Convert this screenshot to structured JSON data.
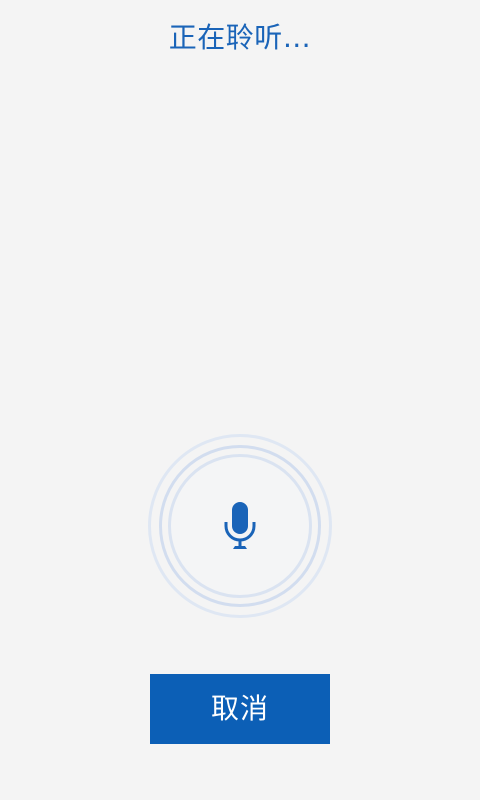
{
  "listening": {
    "status_text": "正在聆听…"
  },
  "mic": {
    "icon": "microphone-icon",
    "accent_color": "#1a64b8"
  },
  "actions": {
    "cancel_label": "取消"
  },
  "colors": {
    "background": "#f4f4f4",
    "button": "#0c5fb6",
    "ring": "#d2ddef"
  }
}
